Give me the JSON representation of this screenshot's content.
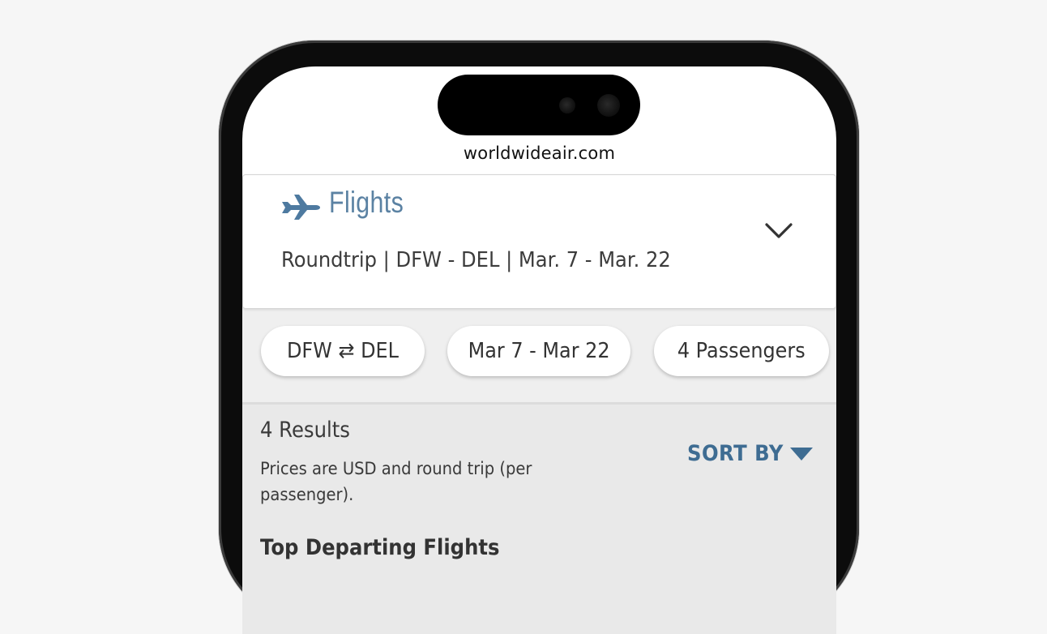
{
  "browser": {
    "url": "worldwideair.com"
  },
  "header": {
    "title": "Flights",
    "trip_summary": "Roundtrip | DFW - DEL | Mar. 7 - Mar. 22",
    "icons": {
      "plane": "airplane-icon",
      "expand": "chevron-down-icon"
    }
  },
  "filters": {
    "route": "DFW ⇄ DEL",
    "dates": "Mar 7 - Mar 22",
    "passengers": "4 Passengers"
  },
  "results": {
    "count_label": "4 Results",
    "price_note": "Prices are USD and round trip (per passenger).",
    "sort_label": "SORT BY",
    "section_heading": "Top Departing Flights"
  },
  "colors": {
    "brand_blue": "#5b82a3",
    "sort_blue": "#3e6c92",
    "page_background": "#f6f6f6",
    "content_background": "#e9e9e9"
  }
}
